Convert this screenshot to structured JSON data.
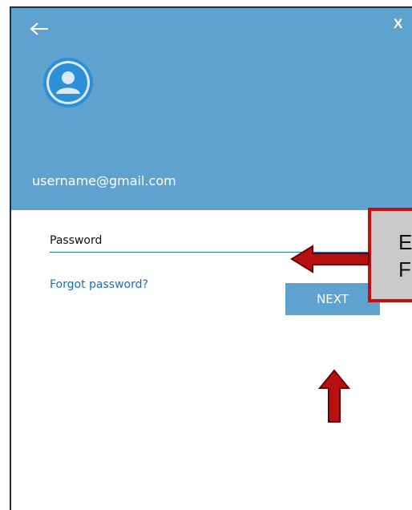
{
  "header": {
    "back_icon": "arrow-left-icon",
    "close_label": "X",
    "avatar_icon": "user-avatar-icon",
    "email": "username@gmail.com"
  },
  "form": {
    "password_placeholder": "Password",
    "forgot_password": "Forgot password?",
    "next_label": "NEXT"
  },
  "annotation": {
    "callout_line1": "E",
    "callout_line2": "F"
  },
  "colors": {
    "header_blue": "#5fa2d0",
    "link_blue": "#1a6fc2",
    "annotation_red": "#c40d0d",
    "callout_gray": "#c9c9c9"
  }
}
